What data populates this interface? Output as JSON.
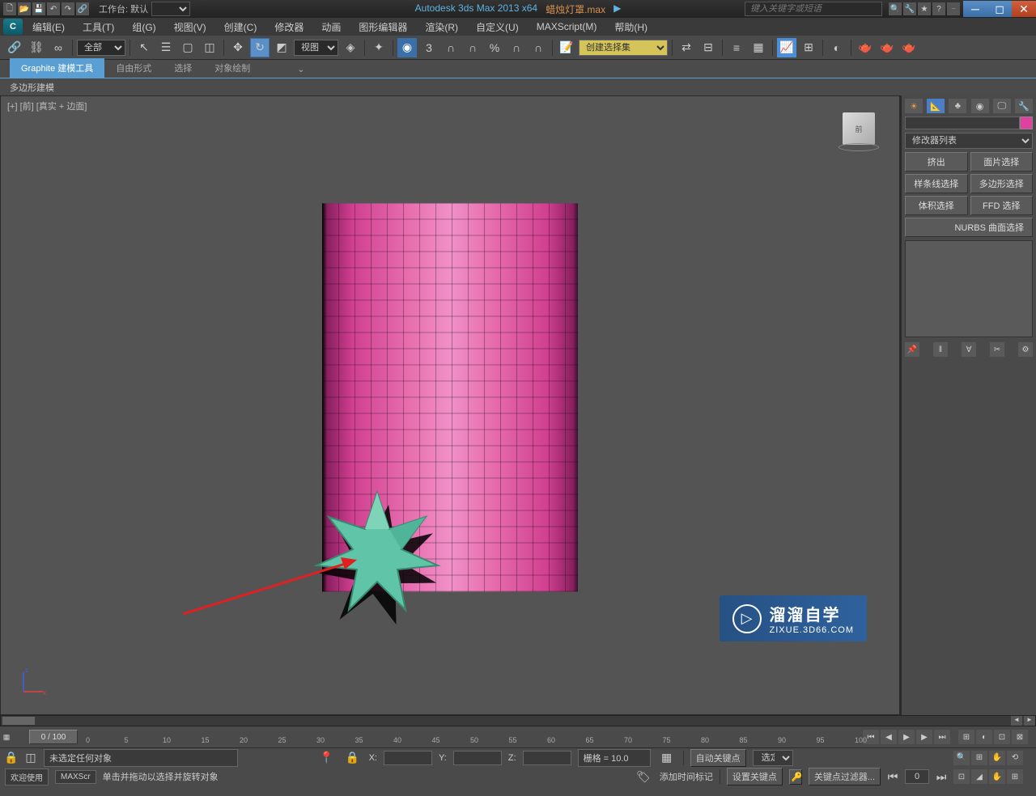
{
  "titlebar": {
    "workspace_label": "工作台: 默认",
    "app_title": "Autodesk 3ds Max  2013 x64",
    "file_name": "蜡烛灯罩.max",
    "search_placeholder": "键入关键字或短语"
  },
  "menu": {
    "edit": "编辑(E)",
    "tools": "工具(T)",
    "group": "组(G)",
    "view": "视图(V)",
    "create": "创建(C)",
    "modifiers": "修改器",
    "animation": "动画",
    "graph_editors": "图形编辑器",
    "rendering": "渲染(R)",
    "customize": "自定义(U)",
    "maxscript": "MAXScript(M)",
    "help": "帮助(H)"
  },
  "toolbar": {
    "selection_filter": "全部",
    "view_mode": "视图",
    "selection_set": "创建选择集"
  },
  "ribbon": {
    "tab1": "Graphite 建模工具",
    "tab2": "自由形式",
    "tab3": "选择",
    "tab4": "对象绘制",
    "content": "多边形建模"
  },
  "viewport": {
    "label": "[+] [前] [真实 + 边面]",
    "viewcube": "前"
  },
  "panel": {
    "modifier_list": "修改器列表",
    "btn_extrude": "挤出",
    "btn_face": "面片选择",
    "btn_spline": "样条线选择",
    "btn_poly": "多边形选择",
    "btn_volume": "体积选择",
    "btn_ffd": "FFD 选择",
    "btn_nurbs": "NURBS 曲面选择"
  },
  "timeline": {
    "frame": "0 / 100",
    "ticks": [
      "0",
      "5",
      "10",
      "15",
      "20",
      "25",
      "30",
      "35",
      "40",
      "45",
      "50",
      "55",
      "60",
      "65",
      "70",
      "75",
      "80",
      "85",
      "90",
      "95",
      "100"
    ]
  },
  "status": {
    "no_selection": "未选定任何对象",
    "hint": "单击并拖动以选择并旋转对象",
    "x_label": "X:",
    "y_label": "Y:",
    "z_label": "Z:",
    "grid": "栅格 = 10.0",
    "auto_key": "自动关键点",
    "selected": "选定对",
    "set_key": "设置关键点",
    "key_filter": "关键点过滤器...",
    "welcome": "欢迎使用",
    "maxscript": "MAXScr",
    "add_time_tag": "添加时间标记",
    "spinner_value": "0"
  },
  "watermark": {
    "text": "溜溜自学",
    "url": "ZIXUE.3D66.COM"
  }
}
